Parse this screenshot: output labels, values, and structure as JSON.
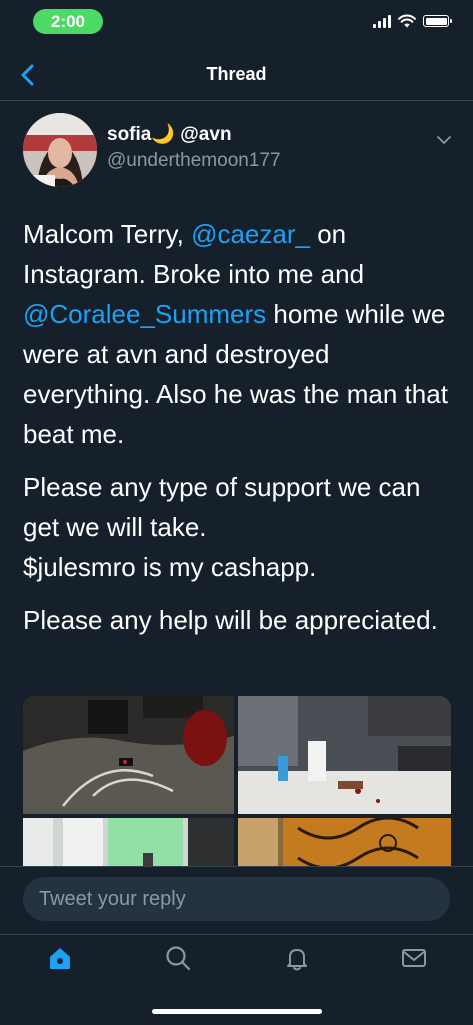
{
  "status": {
    "time": "2:00"
  },
  "nav": {
    "title": "Thread"
  },
  "tweet": {
    "display_name": "sofia🌙 @avn",
    "handle": "@underthemoon177",
    "para1": [
      {
        "t": "Malcom Terry, "
      },
      {
        "t": "@caezar_",
        "m": true
      },
      {
        "t": " on Instagram. Broke into me and "
      },
      {
        "t": "@Coralee_Summers",
        "m": true
      },
      {
        "t": " home while we were at avn and destroyed everything. Also he was the man that beat me."
      }
    ],
    "para2_line1": "Please any type of support we can get we will take.",
    "para2_line2": "$julesmro is my cashapp.",
    "para3": "Please any help will be appreciated."
  },
  "reply": {
    "placeholder": "Tweet your reply"
  },
  "tabs": [
    {
      "name": "home-icon",
      "active": true
    },
    {
      "name": "search-icon",
      "active": false
    },
    {
      "name": "notifications-icon",
      "active": false
    },
    {
      "name": "messages-icon",
      "active": false
    }
  ],
  "colors": {
    "background": "#15202b",
    "accent": "#1da1f2",
    "muted": "#8899a6",
    "divider": "#38444d",
    "time_pill": "#4cd964"
  }
}
